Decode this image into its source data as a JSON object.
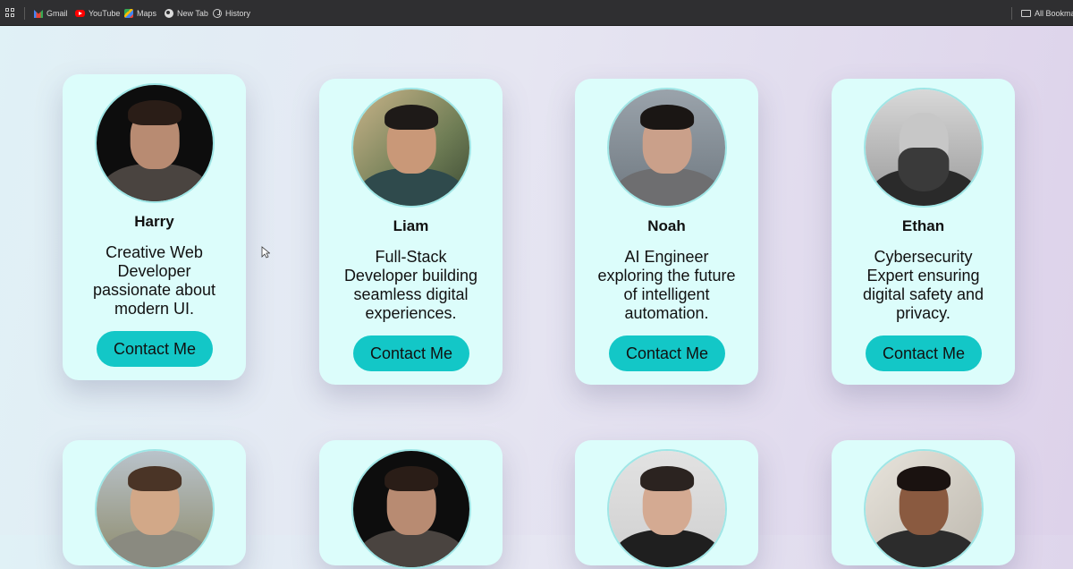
{
  "bookmarks": {
    "items": [
      {
        "label": "Gmail",
        "icon": "gmail-icon"
      },
      {
        "label": "YouTube",
        "icon": "youtube-icon"
      },
      {
        "label": "Maps",
        "icon": "maps-icon"
      },
      {
        "label": "New Tab",
        "icon": "globe-icon"
      },
      {
        "label": "History",
        "icon": "history-icon"
      }
    ],
    "all_bookmarks": "All Bookmar"
  },
  "cards": [
    {
      "name": "Harry",
      "description": "Creative Web Developer passionate about modern UI.",
      "button": "Contact Me"
    },
    {
      "name": "Liam",
      "description": "Full-Stack Developer building seamless digital experiences.",
      "button": "Contact Me"
    },
    {
      "name": "Noah",
      "description": "AI Engineer exploring the future of intelligent automation.",
      "button": "Contact Me"
    },
    {
      "name": "Ethan",
      "description": "Cybersecurity Expert ensuring digital safety and privacy.",
      "button": "Contact Me"
    }
  ],
  "colors": {
    "card_bg": "#dcfdfb",
    "button_bg": "#13c7c7",
    "avatar_border": "#9fe6e6"
  }
}
